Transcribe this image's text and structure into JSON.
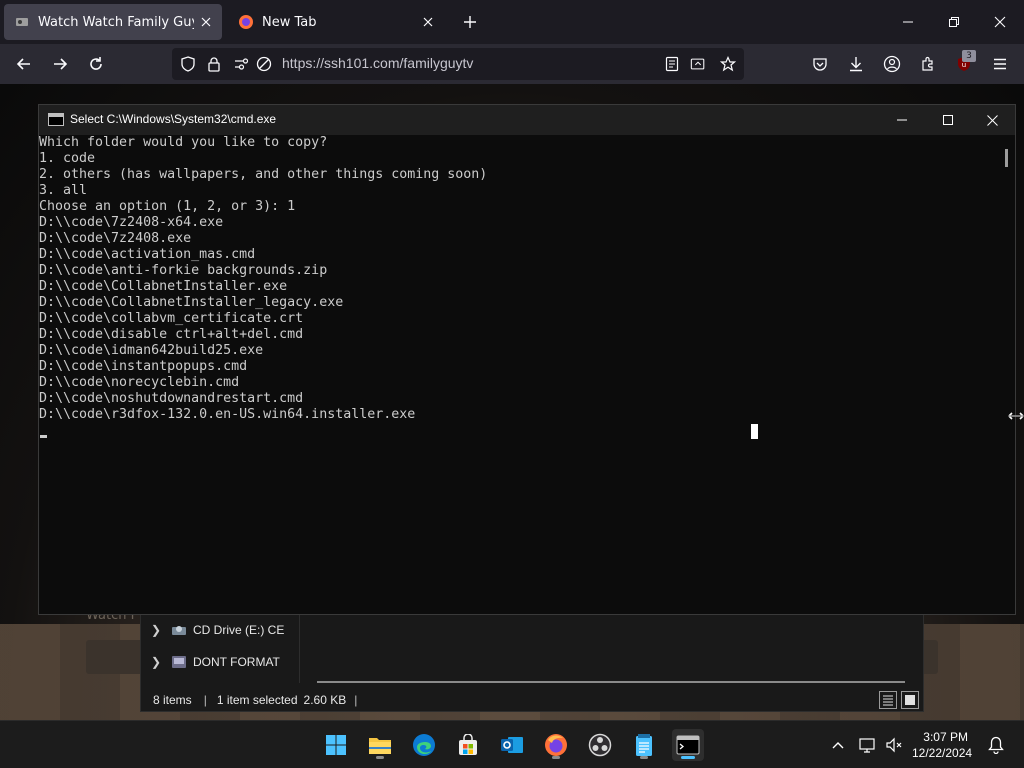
{
  "browser": {
    "tabs": [
      {
        "title": "Watch Watch Family Guy Onlin",
        "active": true
      },
      {
        "title": "New Tab",
        "active": false
      }
    ],
    "url": "https://ssh101.com/familyguytv",
    "extension_badge": "3",
    "icons": {
      "back": "back-arrow-icon",
      "forward": "forward-arrow-icon",
      "reload": "reload-icon",
      "shield": "tracking-protection-icon",
      "lock": "lock-icon",
      "permissions": "permissions-icon",
      "reader": "reader-view-icon",
      "screenshot": "screenshot-icon",
      "bookmark": "bookmark-star-icon",
      "pocket": "pocket-icon",
      "downloads": "download-icon",
      "account": "account-icon",
      "extensions": "extensions-icon",
      "ublock": "ublock-icon",
      "menu": "hamburger-menu-icon"
    }
  },
  "cmd": {
    "title": "Select C:\\Windows\\System32\\cmd.exe",
    "lines": [
      "Which folder would you like to copy?",
      "1. code",
      "2. others (has wallpapers, and other things coming soon)",
      "3. all",
      "Choose an option (1, 2, or 3): 1",
      "D:\\\\code\\7z2408-x64.exe",
      "D:\\\\code\\7z2408.exe",
      "D:\\\\code\\activation_mas.cmd",
      "D:\\\\code\\anti-forkie backgrounds.zip",
      "D:\\\\code\\CollabnetInstaller.exe",
      "D:\\\\code\\CollabnetInstaller_legacy.exe",
      "D:\\\\code\\collabvm_certificate.crt",
      "D:\\\\code\\disable ctrl+alt+del.cmd",
      "D:\\\\code\\idman642build25.exe",
      "D:\\\\code\\instantpopups.cmd",
      "D:\\\\code\\norecyclebin.cmd",
      "D:\\\\code\\noshutdownandrestart.cmd",
      "D:\\\\code\\r3dfox-132.0.en-US.win64.installer.exe"
    ]
  },
  "explorer": {
    "nav_items": [
      {
        "label": "CD Drive (E:) CE"
      },
      {
        "label": "DONT FORMAT"
      }
    ],
    "status": {
      "items": "8 items",
      "selected": "1 item selected",
      "size": "2.60 KB"
    }
  },
  "page": {
    "faint_text": "Watch F"
  },
  "taskbar": {
    "apps": [
      "start-icon",
      "file-explorer-icon",
      "edge-icon",
      "store-icon",
      "outlook-icon",
      "firefox-icon",
      "obs-icon",
      "notepad-icon",
      "terminal-icon"
    ],
    "time": "3:07 PM",
    "date": "12/22/2024"
  }
}
